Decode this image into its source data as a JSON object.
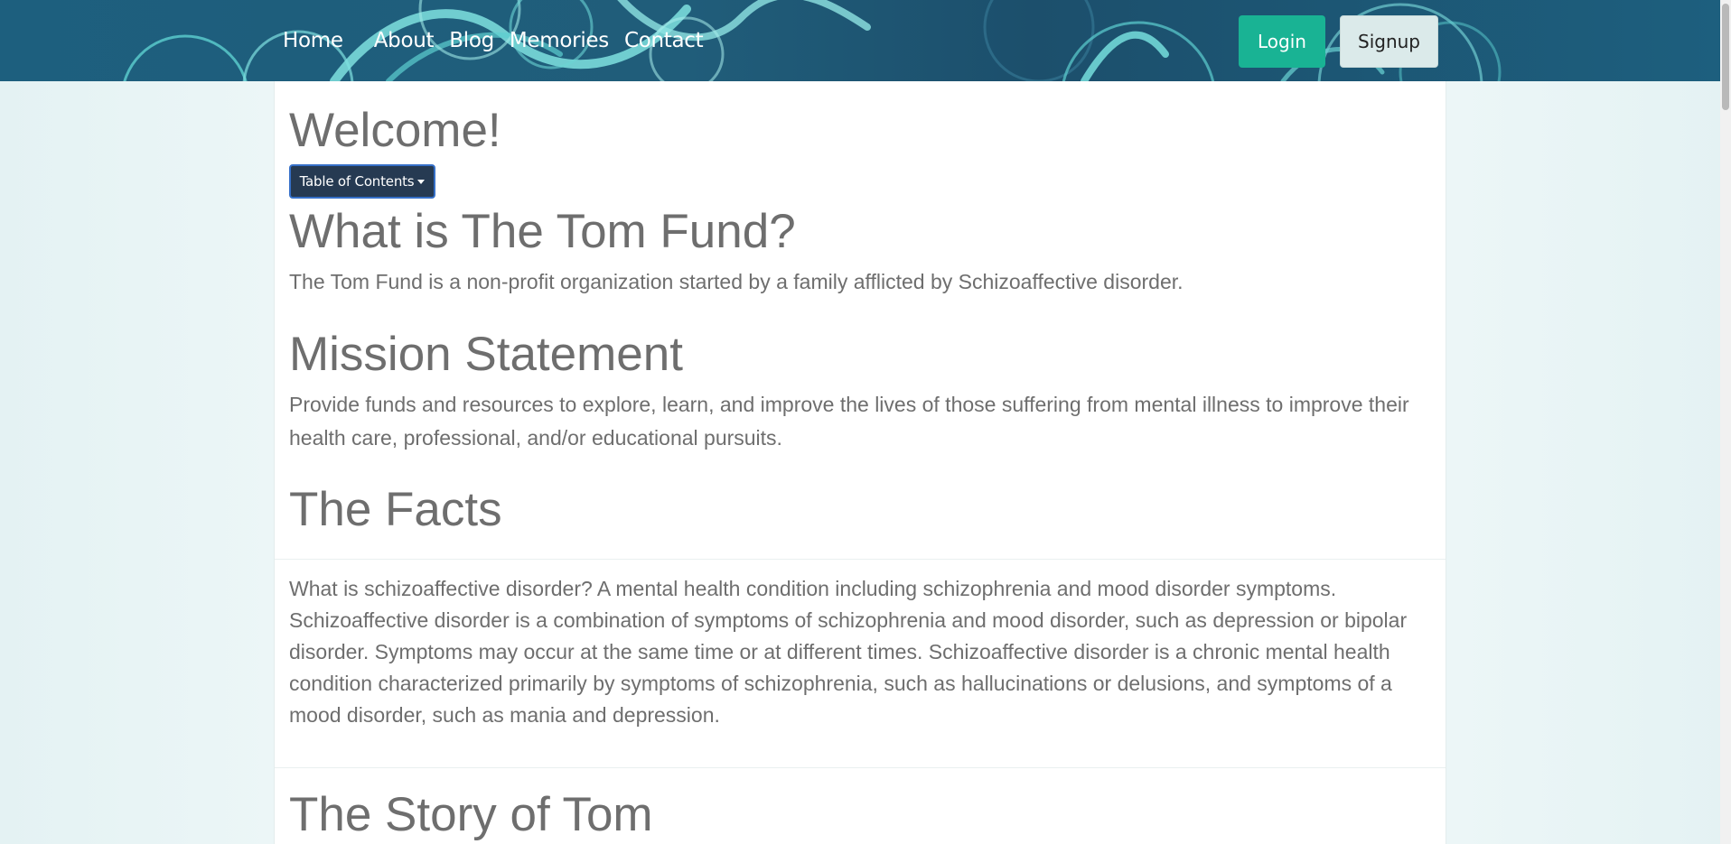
{
  "nav": {
    "links": [
      "Home",
      "About",
      "Blog",
      "Memories",
      "Contact"
    ],
    "login_label": "Login",
    "signup_label": "Signup"
  },
  "main": {
    "welcome": "Welcome!",
    "toc_label": "Table of Contents",
    "sections": [
      {
        "heading": "What is The Tom Fund?",
        "text": "The Tom Fund is a non-profit organization started by a family afflicted by Schizoaffective disorder."
      },
      {
        "heading": "Mission Statement",
        "text": "Provide funds and resources to explore, learn, and improve the lives of those suffering from mental illness to improve their health care, professional, and/or educational pursuits."
      },
      {
        "heading": "The Facts",
        "text": "What is schizoaffective disorder? A mental health condition including schizophrenia and mood disorder symptoms. Schizoaffective disorder is a combination of symptoms of schizophrenia and mood disorder, such as depression or bipolar disorder. Symptoms may occur at the same time or at different times. Schizoaffective disorder is a chronic mental health condition characterized primarily by symptoms of schizophrenia, such as hallucinations or delusions, and symptoms of a mood disorder, such as mania and depression."
      },
      {
        "heading": "The Story of Tom"
      }
    ]
  },
  "colors": {
    "navbar": "#1d5f7e",
    "login": "#19b394",
    "signup": "#dbeaea",
    "toc": "#263a52"
  }
}
